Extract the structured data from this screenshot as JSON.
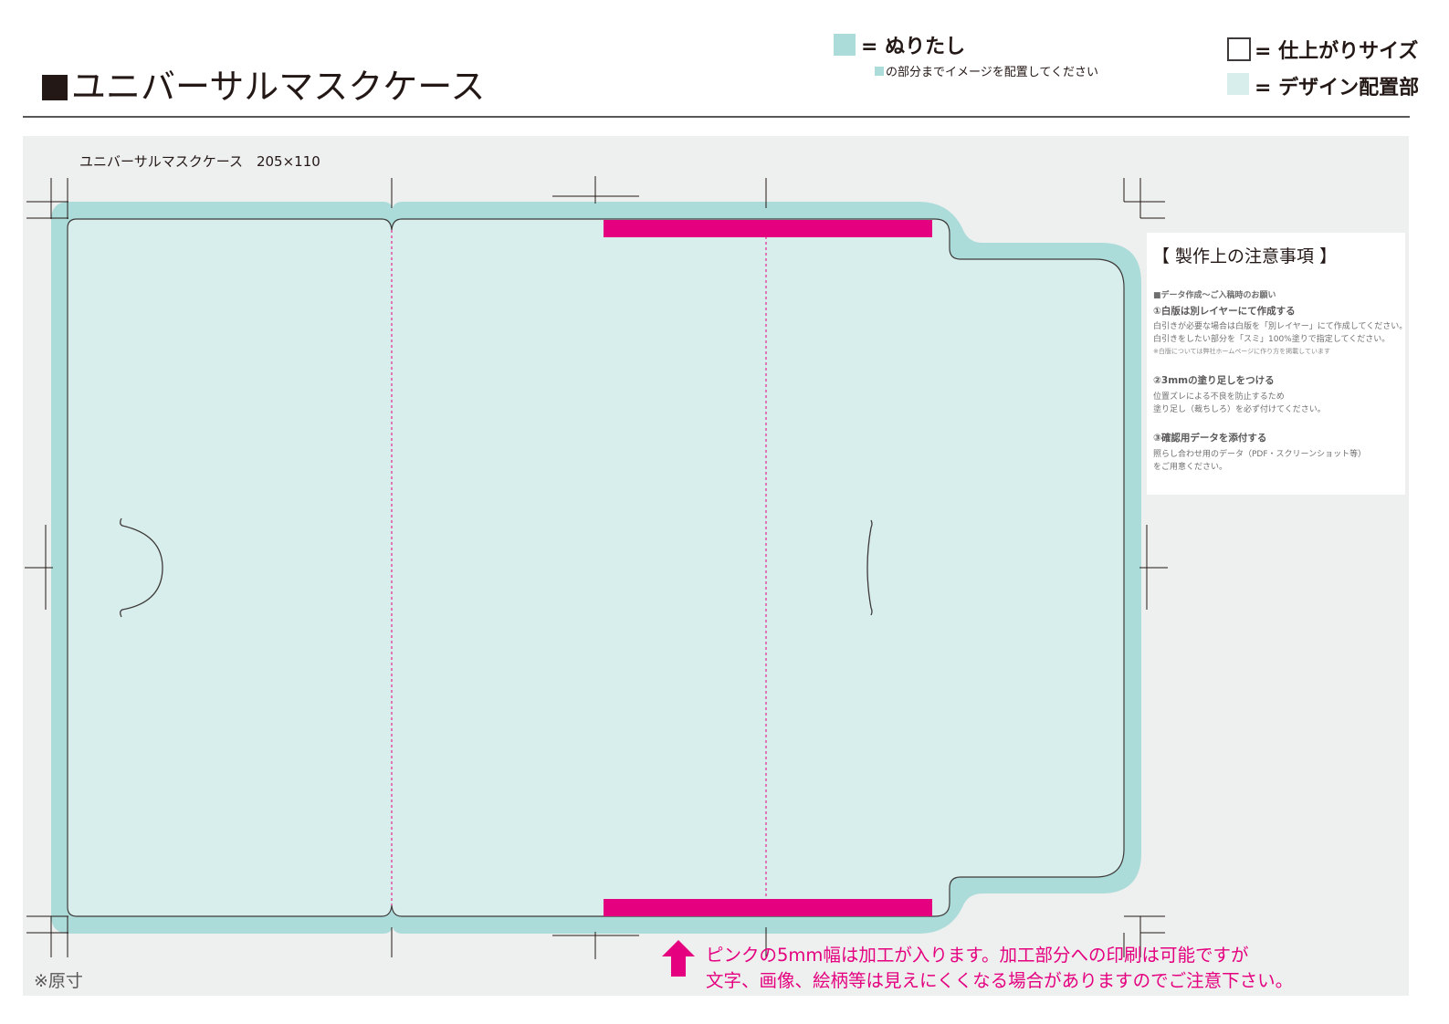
{
  "header": {
    "title": "ユニバーサルマスクケース"
  },
  "legend": {
    "bleed_label": "= ぬりたし",
    "bleed_note": "の部分までイメージを配置してください",
    "finish_label": "= 仕上がりサイズ",
    "design_label": "= デザイン配置部"
  },
  "template": {
    "label": "ユニバーサルマスクケース　205×110"
  },
  "notes": {
    "title": "【 製作上の注意事項 】",
    "subtitle": "■データ作成〜ご入稿時のお願い",
    "item1_head": "①白版は別レイヤーにて作成する",
    "item1_line1": "白引きが必要な場合は白版を「別レイヤー」にて作成してください。",
    "item1_line2": "白引きをしたい部分を「スミ」100%塗りで指定してください。",
    "item1_footnote": "※白版については弊社ホームページに作り方を掲載しています",
    "item2_head": "②3mmの塗り足しをつける",
    "item2_line1": "位置ズレによる不良を防止するため",
    "item2_line2": "塗り足し（裁ちしろ）を必ず付けてください。",
    "item3_head": "③確認用データを添付する",
    "item3_line1": "照らし合わせ用のデータ（PDF・スクリーンショット等）",
    "item3_line2": "をご用意ください。"
  },
  "bottom": {
    "pink_note_line1": "ピンクの5mm幅は加工が入ります。加工部分への印刷は可能ですが",
    "pink_note_line2": "文字、画像、絵柄等は見えにくくなる場合がありますのでご注意下さい。",
    "actual_size_note": "※原寸"
  },
  "colors": {
    "bleed": "#abdcda",
    "design_area": "#d8eeec",
    "template_background": "#eeefef",
    "processing_band": "#e4007f",
    "fold_line": "#e4007f",
    "outline": "#3e3a39"
  }
}
